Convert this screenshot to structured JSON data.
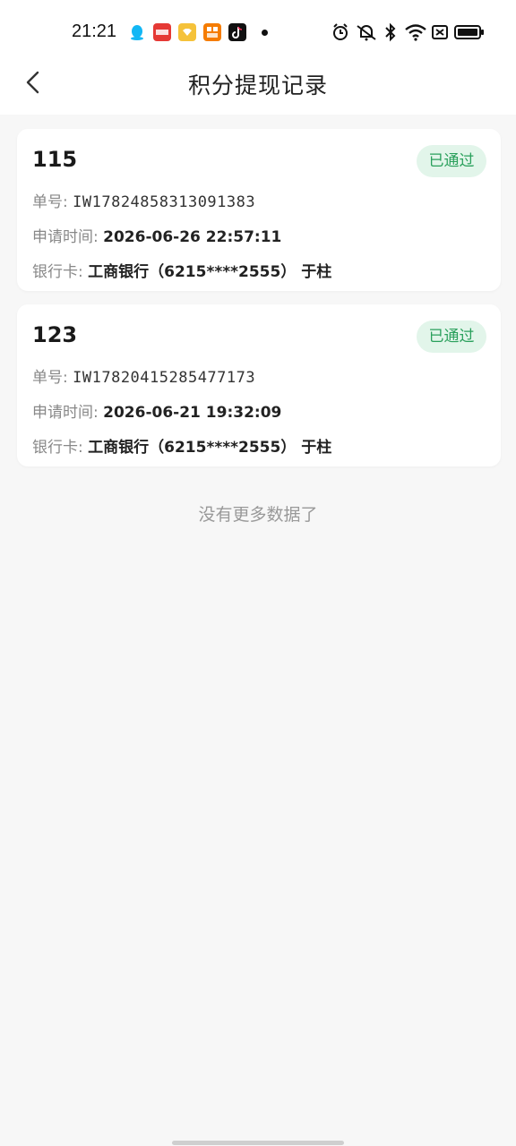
{
  "status_bar": {
    "time": "21:21",
    "notification_icons": [
      "qq-icon",
      "toutiao-icon",
      "wallet-app-icon",
      "shopping-app-icon",
      "tiktok-icon"
    ],
    "system_icons": [
      "alarm-icon",
      "mute-icon",
      "bluetooth-icon",
      "wifi-icon",
      "sim-off-icon",
      "battery-icon"
    ]
  },
  "header": {
    "title": "积分提现记录"
  },
  "records": [
    {
      "amount": "115",
      "status": "已通过",
      "order_label": "单号:",
      "order_no": "IW17824858313091383",
      "time_label": "申请时间:",
      "time": "2026-06-26 22:57:11",
      "bank_label": "银行卡:",
      "bank": "工商银行（6215****2555） 于柱"
    },
    {
      "amount": "123",
      "status": "已通过",
      "order_label": "单号:",
      "order_no": "IW17820415285477173",
      "time_label": "申请时间:",
      "time": "2026-06-21 19:32:09",
      "bank_label": "银行卡:",
      "bank": "工商银行（6215****2555） 于柱"
    }
  ],
  "footer": {
    "no_more": "没有更多数据了"
  },
  "colors": {
    "status_badge_bg": "#e2f5ea",
    "status_badge_text": "#2aa05c",
    "page_bg": "#f7f7f7"
  }
}
